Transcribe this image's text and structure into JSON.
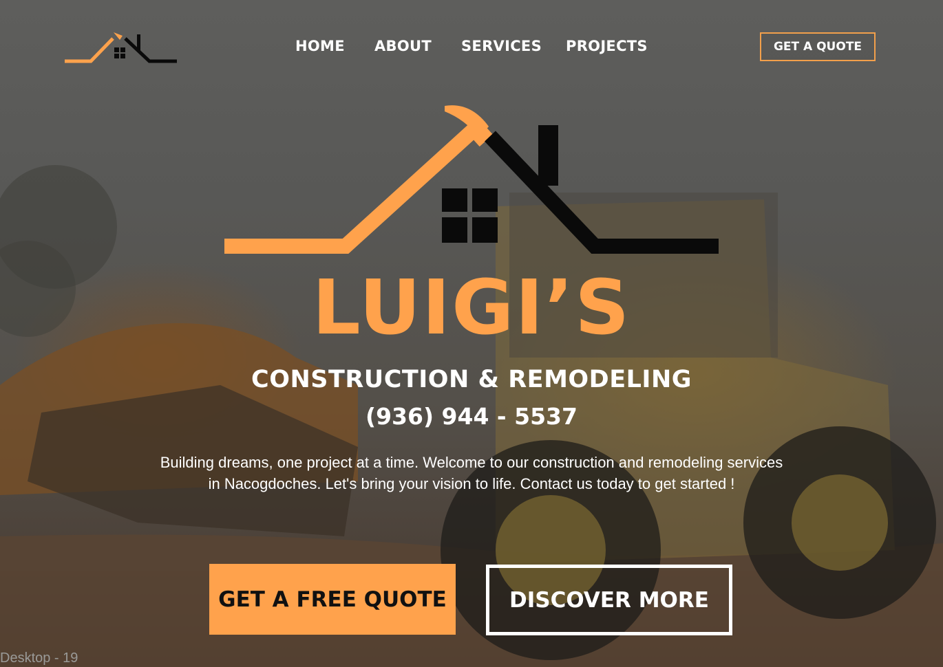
{
  "nav": {
    "items": [
      "HOME",
      "ABOUT",
      "SERVICES",
      "PROJECTS"
    ],
    "quote_button": "GET A QUOTE"
  },
  "hero": {
    "brand": "LUIGI’S",
    "tagline": "CONSTRUCTION & REMODELING",
    "phone": "(936) 944 - 5537",
    "description": "Building dreams, one project at a time. Welcome to our construction and remodeling services in Nacogdoches. Let's bring your vision to life. Contact us today to get started !",
    "primary_cta": "GET A FREE QUOTE",
    "secondary_cta": "DISCOVER MORE"
  },
  "frame_label": "Desktop - 19",
  "colors": {
    "accent": "#ffa24c",
    "logo_dark": "#0a0a0a",
    "text": "#ffffff"
  },
  "icons": {
    "logo": "house-roof-hammer-logo",
    "background": "construction-loader-photo"
  }
}
